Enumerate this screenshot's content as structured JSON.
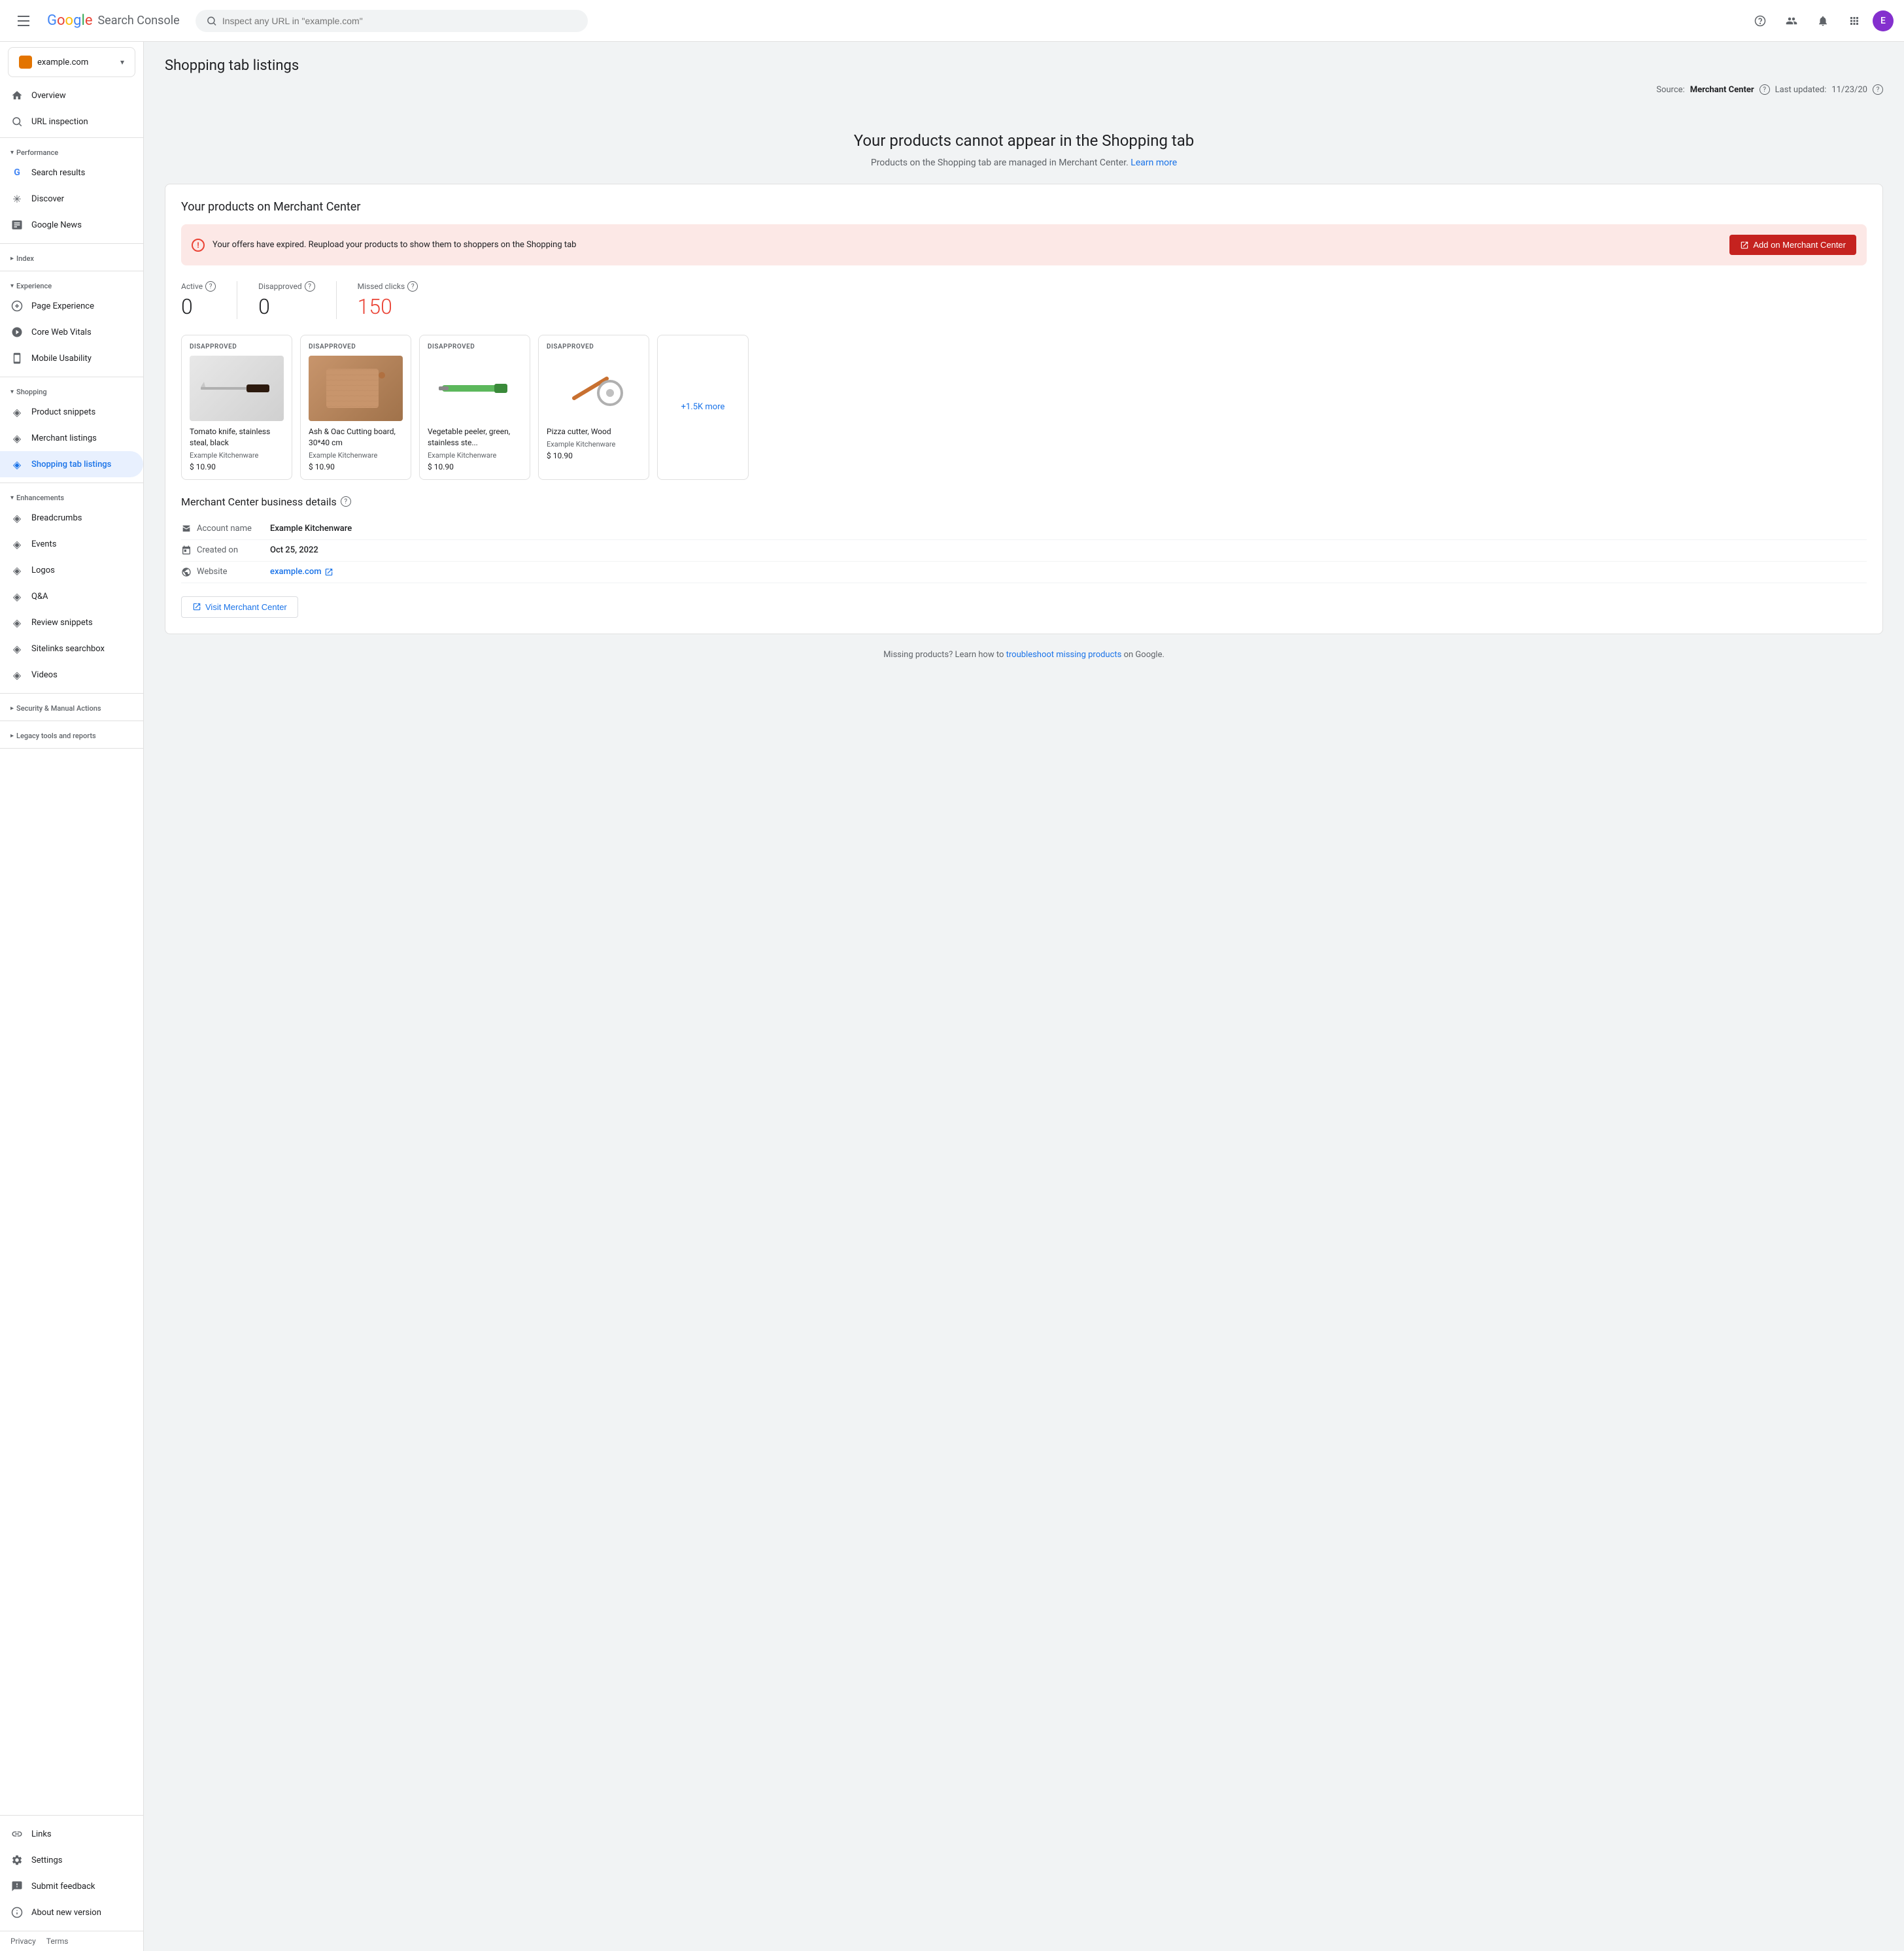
{
  "topbar": {
    "hamburger_label": "Menu",
    "logo_letters": [
      "G",
      "o",
      "o",
      "g",
      "l",
      "e"
    ],
    "product_name": "Search Console",
    "search_placeholder": "Inspect any URL in \"example.com\"",
    "help_icon": "help",
    "people_icon": "people",
    "bell_icon": "notifications",
    "grid_icon": "apps",
    "avatar_initial": "E"
  },
  "sidebar": {
    "property": {
      "name": "example.com",
      "icon_color": "#e37400"
    },
    "nav": [
      {
        "id": "overview",
        "label": "Overview",
        "icon": "home"
      },
      {
        "id": "url-inspection",
        "label": "URL inspection",
        "icon": "search"
      }
    ],
    "sections": [
      {
        "label": "Performance",
        "collapsed": false,
        "items": [
          {
            "id": "search-results",
            "label": "Search results",
            "icon": "google"
          },
          {
            "id": "discover",
            "label": "Discover",
            "icon": "asterisk"
          },
          {
            "id": "google-news",
            "label": "Google News",
            "icon": "news"
          }
        ]
      },
      {
        "label": "Index",
        "collapsed": true,
        "items": []
      },
      {
        "label": "Experience",
        "collapsed": false,
        "items": [
          {
            "id": "page-experience",
            "label": "Page Experience",
            "icon": "plus-circle"
          },
          {
            "id": "core-web-vitals",
            "label": "Core Web Vitals",
            "icon": "dial"
          },
          {
            "id": "mobile-usability",
            "label": "Mobile Usability",
            "icon": "phone"
          }
        ]
      },
      {
        "label": "Shopping",
        "collapsed": false,
        "items": [
          {
            "id": "product-snippets",
            "label": "Product snippets",
            "icon": "tag"
          },
          {
            "id": "merchant-listings",
            "label": "Merchant listings",
            "icon": "tag"
          },
          {
            "id": "shopping-tab-listings",
            "label": "Shopping tab listings",
            "icon": "tag",
            "active": true
          }
        ]
      },
      {
        "label": "Enhancements",
        "collapsed": false,
        "items": [
          {
            "id": "breadcrumbs",
            "label": "Breadcrumbs",
            "icon": "tag"
          },
          {
            "id": "events",
            "label": "Events",
            "icon": "tag"
          },
          {
            "id": "logos",
            "label": "Logos",
            "icon": "tag"
          },
          {
            "id": "qa",
            "label": "Q&A",
            "icon": "tag"
          },
          {
            "id": "review-snippets",
            "label": "Review snippets",
            "icon": "tag"
          },
          {
            "id": "sitelinks-searchbox",
            "label": "Sitelinks searchbox",
            "icon": "tag"
          },
          {
            "id": "videos",
            "label": "Videos",
            "icon": "tag"
          }
        ]
      },
      {
        "label": "Security & Manual Actions",
        "collapsed": true,
        "items": []
      },
      {
        "label": "Legacy tools and reports",
        "collapsed": true,
        "items": []
      }
    ],
    "bottom_items": [
      {
        "id": "links",
        "label": "Links",
        "icon": "link"
      },
      {
        "id": "settings",
        "label": "Settings",
        "icon": "settings"
      },
      {
        "id": "submit-feedback",
        "label": "Submit feedback",
        "icon": "feedback"
      },
      {
        "id": "about-new-version",
        "label": "About new version",
        "icon": "info"
      }
    ]
  },
  "page": {
    "title": "Shopping tab listings",
    "meta": {
      "source_label": "Source:",
      "source_value": "Merchant Center",
      "last_updated_label": "Last updated:",
      "last_updated_value": "11/23/20"
    },
    "hero": {
      "heading": "Your products cannot appear in the Shopping tab",
      "description": "Products on the Shopping tab are managed in Merchant Center.",
      "learn_more": "Learn more"
    },
    "merchant_card": {
      "title": "Your products on Merchant Center",
      "alert": {
        "text": "Your offers have expired. Reupload your products to show them to shoppers on the Shopping tab",
        "button_label": "Add on Merchant Center",
        "button_icon": "external-link"
      },
      "stats": [
        {
          "label": "Active",
          "value": "0",
          "red": false
        },
        {
          "label": "Disapproved",
          "value": "0",
          "red": false
        },
        {
          "label": "Missed clicks",
          "value": "150",
          "red": true
        }
      ],
      "products": [
        {
          "badge": "DISAPPROVED",
          "name": "Tomato knife, stainless steal, black",
          "shop": "Example Kitchenware",
          "price": "$ 10.90",
          "type": "knife"
        },
        {
          "badge": "DISAPPROVED",
          "name": "Ash & Oac Cutting board, 30*40 cm",
          "shop": "Example Kitchenware",
          "price": "$ 10.90",
          "type": "board"
        },
        {
          "badge": "DISAPPROVED",
          "name": "Vegetable peeler, green, stainless ste...",
          "shop": "Example Kitchenware",
          "price": "$ 10.90",
          "type": "peeler"
        },
        {
          "badge": "DISAPPROVED",
          "name": "Pizza cutter, Wood",
          "shop": "Example Kitchenware",
          "price": "$ 10.90",
          "type": "cutter"
        }
      ],
      "more_label": "+1.5K more"
    },
    "business_details": {
      "title": "Merchant Center business details",
      "rows": [
        {
          "icon": "store",
          "label": "Account name",
          "value": "Example Kitchenware"
        },
        {
          "icon": "calendar",
          "label": "Created on",
          "value": "Oct 25, 2022"
        },
        {
          "icon": "web",
          "label": "Website",
          "value": "example.com",
          "link": true
        }
      ],
      "visit_button": "Visit Merchant Center"
    },
    "footer_note": {
      "prefix": "Missing products? Learn how to",
      "link_text": "troubleshoot missing products",
      "suffix": "on Google."
    }
  },
  "footer": {
    "links": [
      "Privacy",
      "Terms"
    ]
  }
}
